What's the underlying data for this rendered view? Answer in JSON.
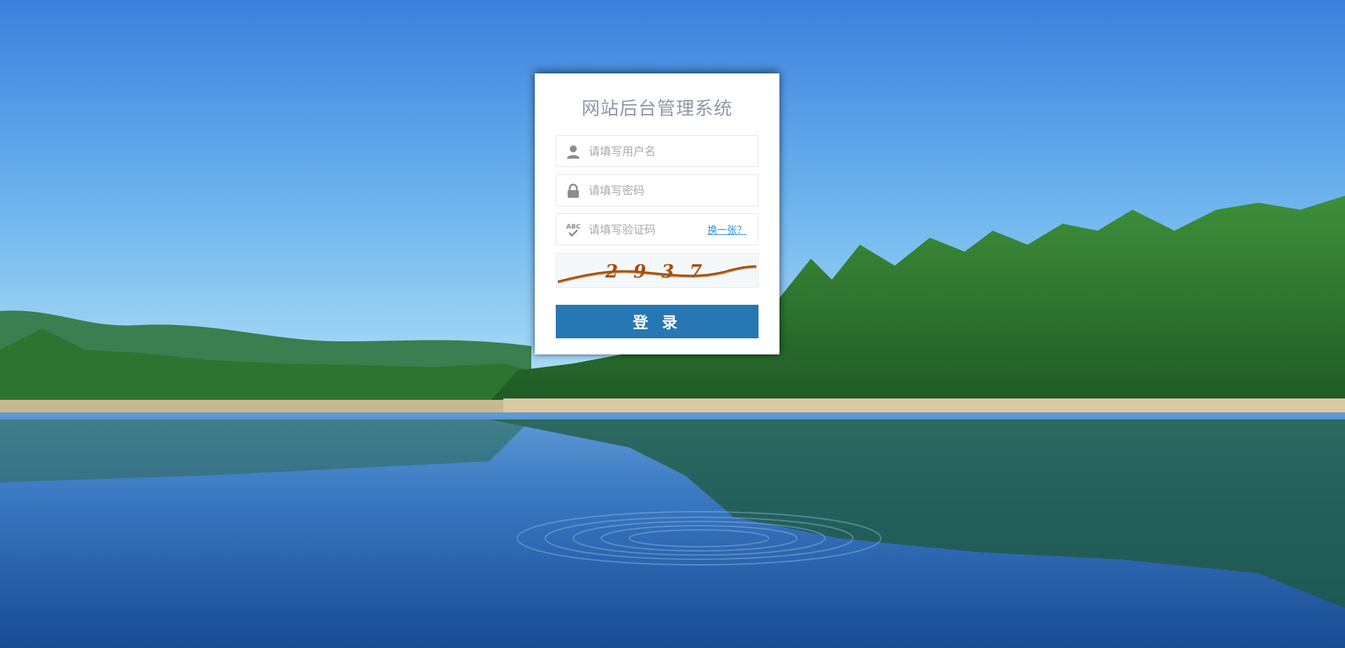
{
  "login": {
    "title": "网站后台管理系统",
    "username_placeholder": "请填写用户名",
    "password_placeholder": "请填写密码",
    "captcha_placeholder": "请填写验证码",
    "refresh_captcha_label": "换一张？",
    "captcha_text": "2937",
    "submit_label": "登 录"
  },
  "icons": {
    "user": "user-icon",
    "lock": "lock-icon",
    "captcha": "abc-check-icon"
  },
  "colors": {
    "primary_button": "#2777b5",
    "link": "#2e8fd8",
    "title": "#8a98a8",
    "captcha_text": "#a4500f"
  }
}
